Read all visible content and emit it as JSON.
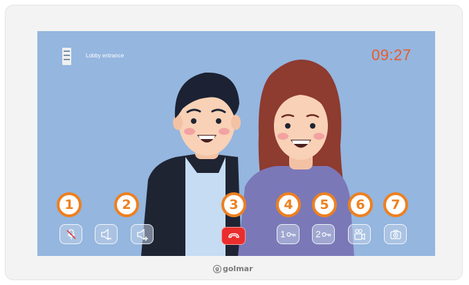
{
  "header": {
    "source_label": "Lobby entrance",
    "time": "09:27",
    "source_icon": "door-panel-icon"
  },
  "controls": [
    {
      "id": "mute",
      "icon": "microphone-muted-icon",
      "badge": "1",
      "label": ""
    },
    {
      "id": "volume-down",
      "icon": "speaker-minus-icon",
      "badge": "2",
      "label": ""
    },
    {
      "id": "volume-up",
      "icon": "speaker-plus-icon",
      "badge": "2",
      "label": ""
    },
    {
      "id": "hang-up",
      "icon": "phone-hangup-icon",
      "badge": "3",
      "label": ""
    },
    {
      "id": "door-1",
      "icon": "key-icon",
      "badge": "4",
      "label": "1"
    },
    {
      "id": "door-2",
      "icon": "key-icon",
      "badge": "5",
      "label": "2"
    },
    {
      "id": "record",
      "icon": "video-camera-icon",
      "badge": "6",
      "label": ""
    },
    {
      "id": "snapshot",
      "icon": "camera-icon",
      "badge": "7",
      "label": ""
    }
  ],
  "badges": {
    "b1": "1",
    "b2": "2",
    "b3": "3",
    "b4": "4",
    "b5": "5",
    "b6": "6",
    "b7": "7"
  },
  "brand": {
    "name": "golmar"
  },
  "colors": {
    "screen": "#94b6df",
    "clock": "#ea5a2a",
    "badge": "#ed8020",
    "hangup": "#ea2d2d"
  }
}
